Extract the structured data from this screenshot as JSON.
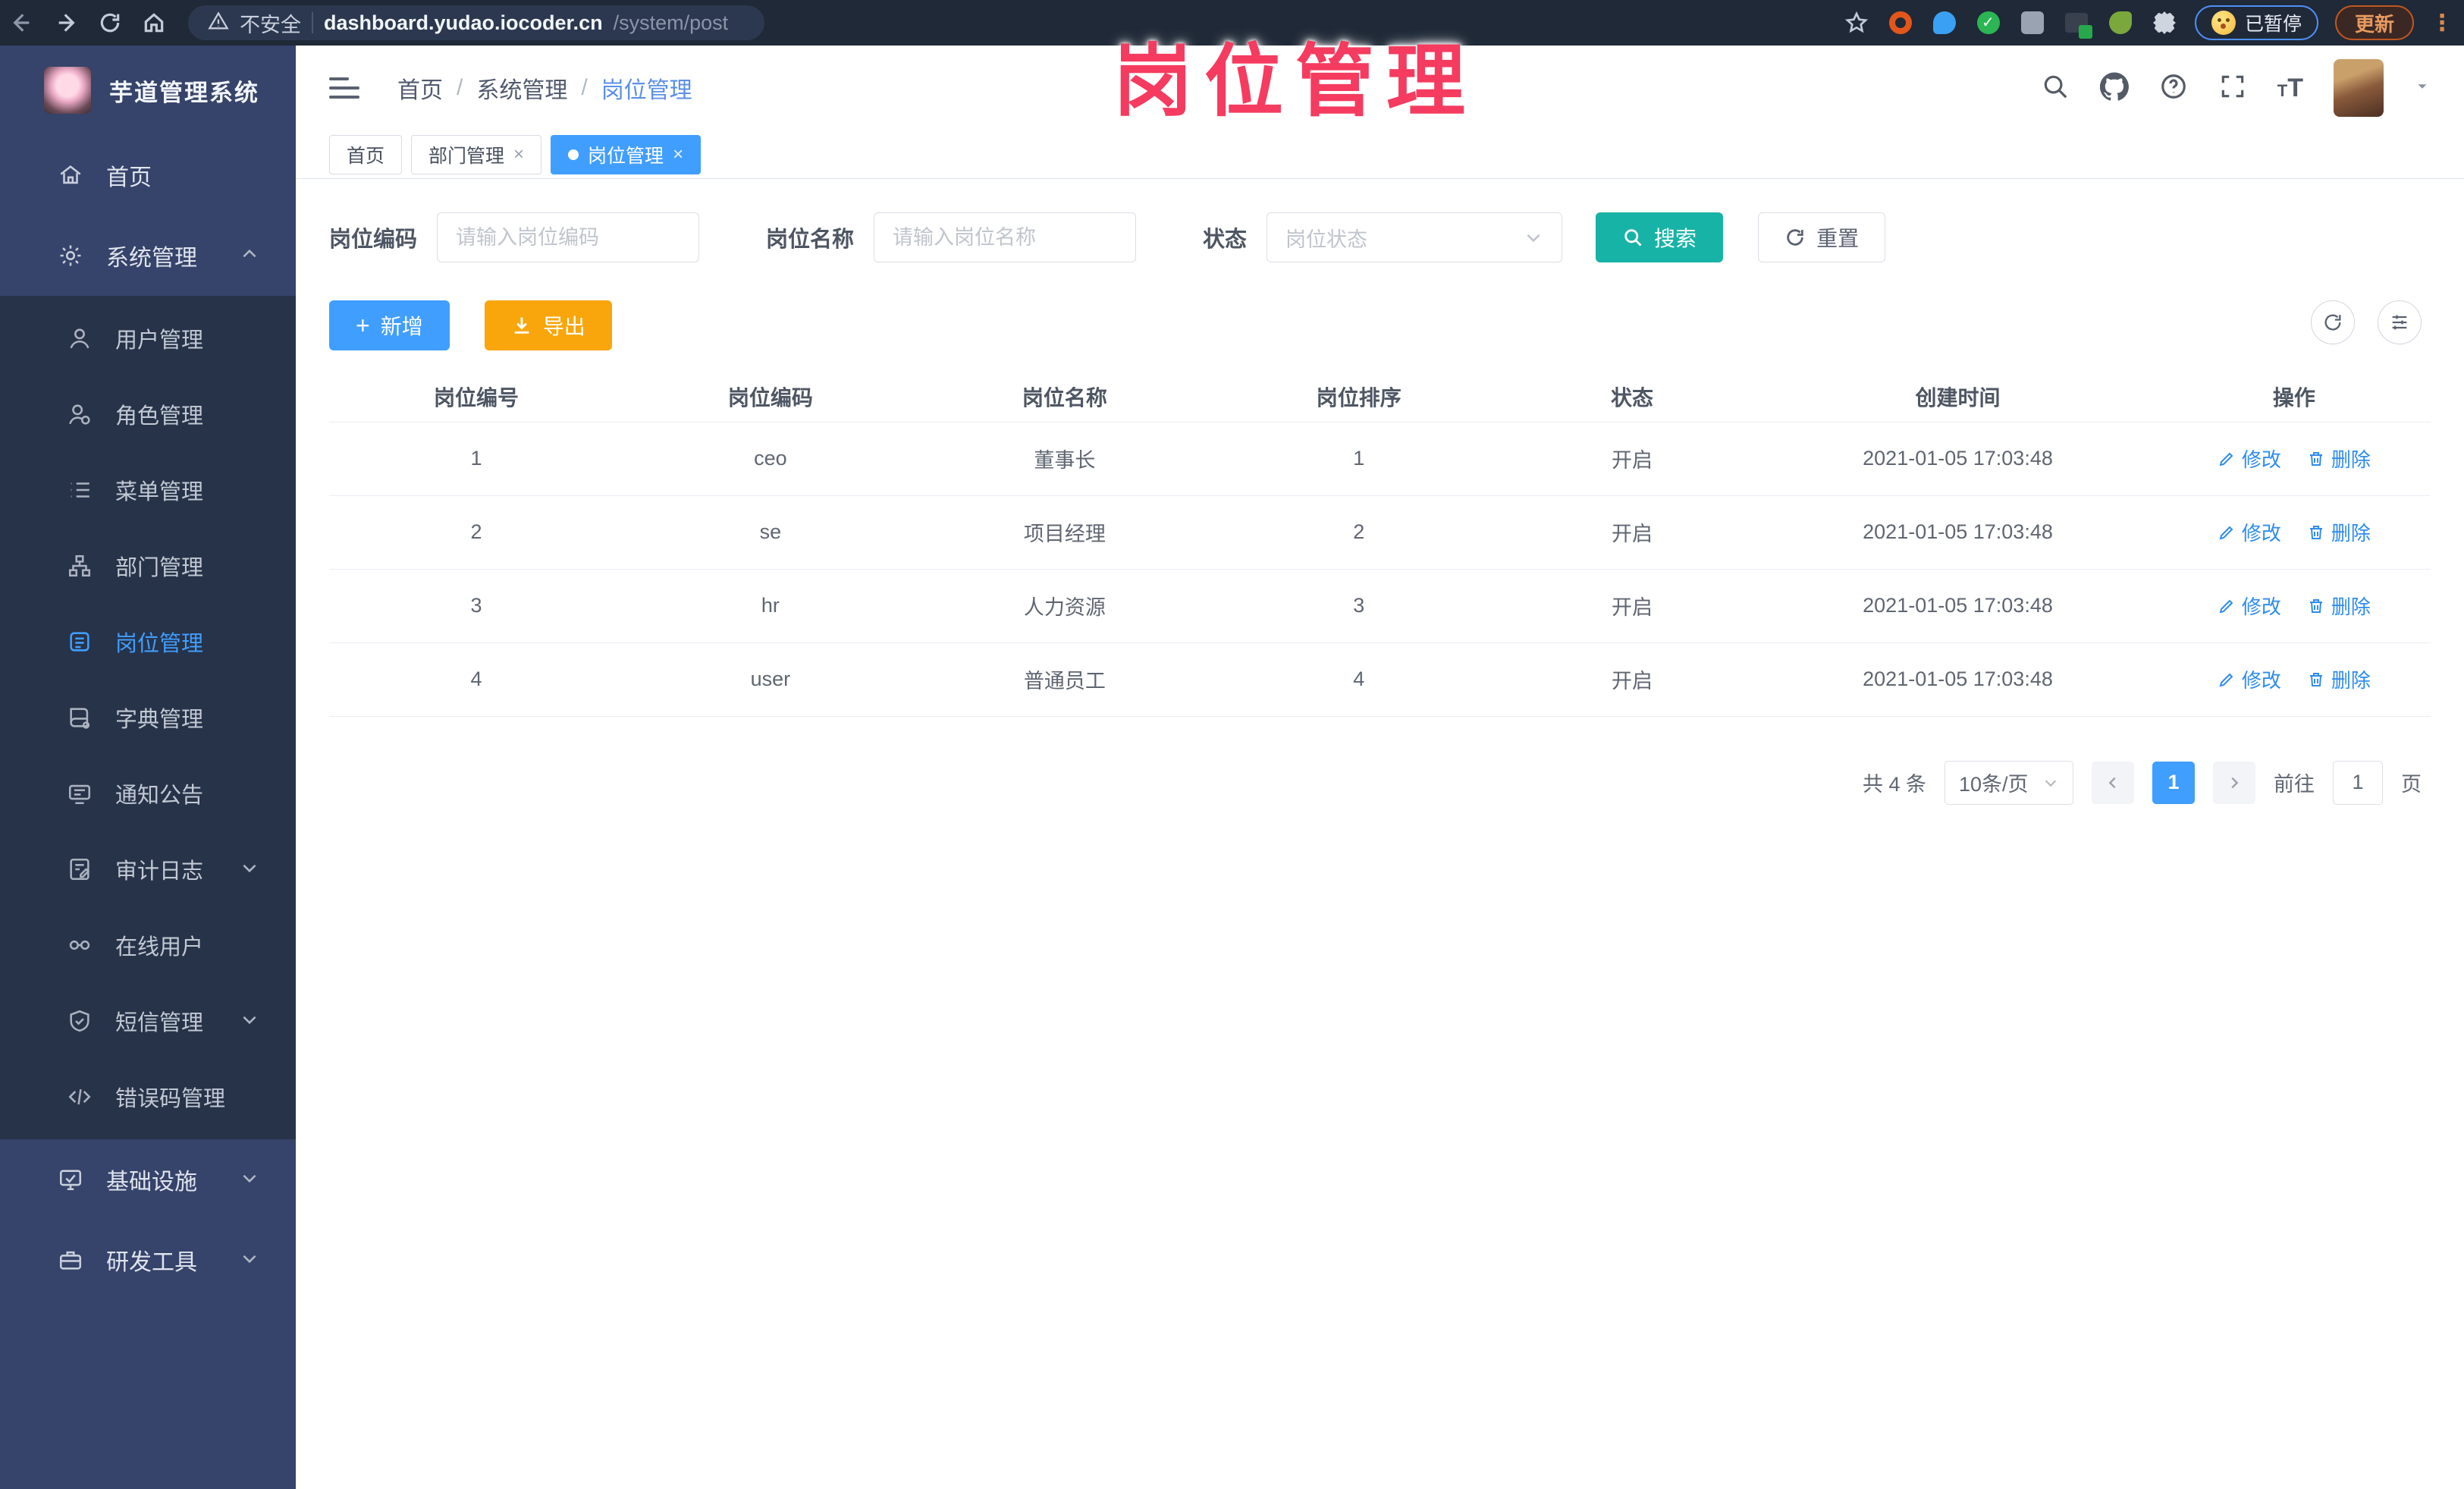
{
  "browser": {
    "security_label": "不安全",
    "url_host": "dashboard.yudao.iocoder.cn",
    "url_path": "/system/post",
    "paused_label": "已暂停",
    "update_label": "更新"
  },
  "watermark": "岗位管理",
  "sidebar": {
    "logo_title": "芋道管理系统",
    "home": "首页",
    "system": "系统管理",
    "submenu": [
      "用户管理",
      "角色管理",
      "菜单管理",
      "部门管理",
      "岗位管理",
      "字典管理",
      "通知公告",
      "审计日志",
      "在线用户",
      "短信管理",
      "错误码管理"
    ],
    "infra": "基础设施",
    "devtools": "研发工具"
  },
  "breadcrumb": [
    "首页",
    "系统管理",
    "岗位管理"
  ],
  "tabs": [
    {
      "label": "首页"
    },
    {
      "label": "部门管理"
    },
    {
      "label": "岗位管理"
    }
  ],
  "filters": {
    "code_label": "岗位编码",
    "code_placeholder": "请输入岗位编码",
    "name_label": "岗位名称",
    "name_placeholder": "请输入岗位名称",
    "status_label": "状态",
    "status_placeholder": "岗位状态",
    "search_label": "搜索",
    "reset_label": "重置"
  },
  "toolbar": {
    "add_label": "新增",
    "export_label": "导出"
  },
  "table": {
    "columns": [
      "岗位编号",
      "岗位编码",
      "岗位名称",
      "岗位排序",
      "状态",
      "创建时间",
      "操作"
    ],
    "rows": [
      {
        "id": "1",
        "code": "ceo",
        "name": "董事长",
        "sort": "1",
        "status": "开启",
        "created": "2021-01-05 17:03:48"
      },
      {
        "id": "2",
        "code": "se",
        "name": "项目经理",
        "sort": "2",
        "status": "开启",
        "created": "2021-01-05 17:03:48"
      },
      {
        "id": "3",
        "code": "hr",
        "name": "人力资源",
        "sort": "3",
        "status": "开启",
        "created": "2021-01-05 17:03:48"
      },
      {
        "id": "4",
        "code": "user",
        "name": "普通员工",
        "sort": "4",
        "status": "开启",
        "created": "2021-01-05 17:03:48"
      }
    ],
    "edit_label": "修改",
    "delete_label": "删除"
  },
  "pagination": {
    "total": "共 4 条",
    "page_size": "10条/页",
    "current": "1",
    "goto_label": "前往",
    "goto_value": "1",
    "page_unit": "页"
  },
  "icons": {
    "close": "×",
    "separator": "/",
    "more_vertical": "⋮"
  },
  "colors": {
    "accent": "#409eff",
    "search_teal": "#17b3a6",
    "export_orange": "#f9a60c",
    "watermark_pink": "#f53b5f"
  }
}
